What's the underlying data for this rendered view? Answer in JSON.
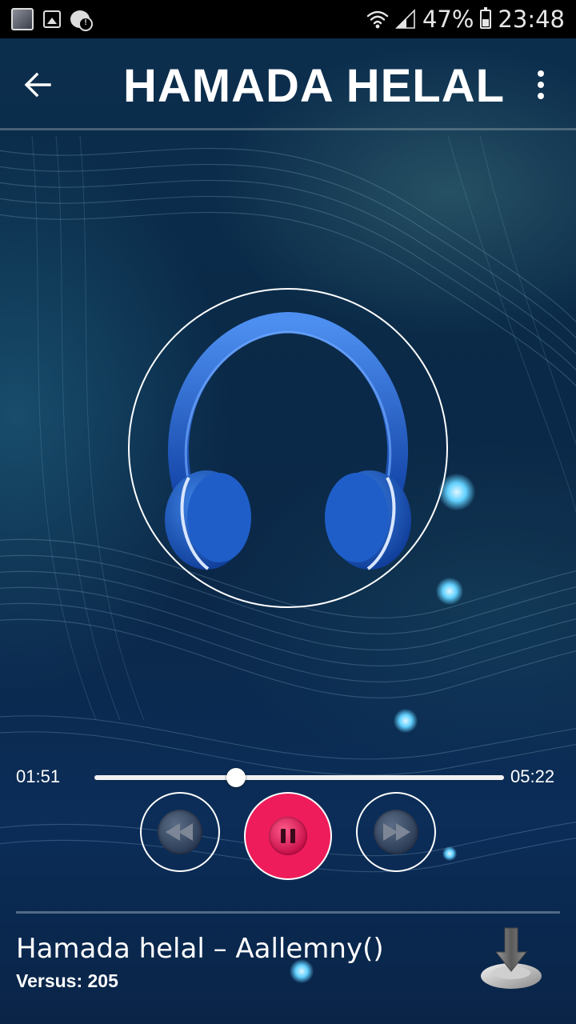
{
  "status_bar": {
    "battery_percent": "47%",
    "time": "23:48",
    "icons": [
      "avatar-notification-icon",
      "image-notification-icon",
      "chat-alert-icon",
      "wifi-icon",
      "signal-icon",
      "battery-icon"
    ]
  },
  "app_bar": {
    "title": "HAMADA HELAL",
    "back_icon": "arrow-back-icon",
    "menu_icon": "more-vert-icon"
  },
  "player": {
    "artwork": "headphones-icon",
    "current_time": "01:51",
    "total_time": "05:22",
    "progress": 0.345,
    "controls": {
      "rewind_icon": "rewind-icon",
      "play_state": "playing",
      "pause_icon": "pause-icon",
      "forward_icon": "fast-forward-icon"
    }
  },
  "track": {
    "title": "Hamada helal – Aallemny()",
    "versus": "Versus: 205",
    "download_icon": "download-icon"
  },
  "colors": {
    "accent": "#ee1c5b",
    "background": "#0b2747",
    "status_bar": "#000000"
  }
}
